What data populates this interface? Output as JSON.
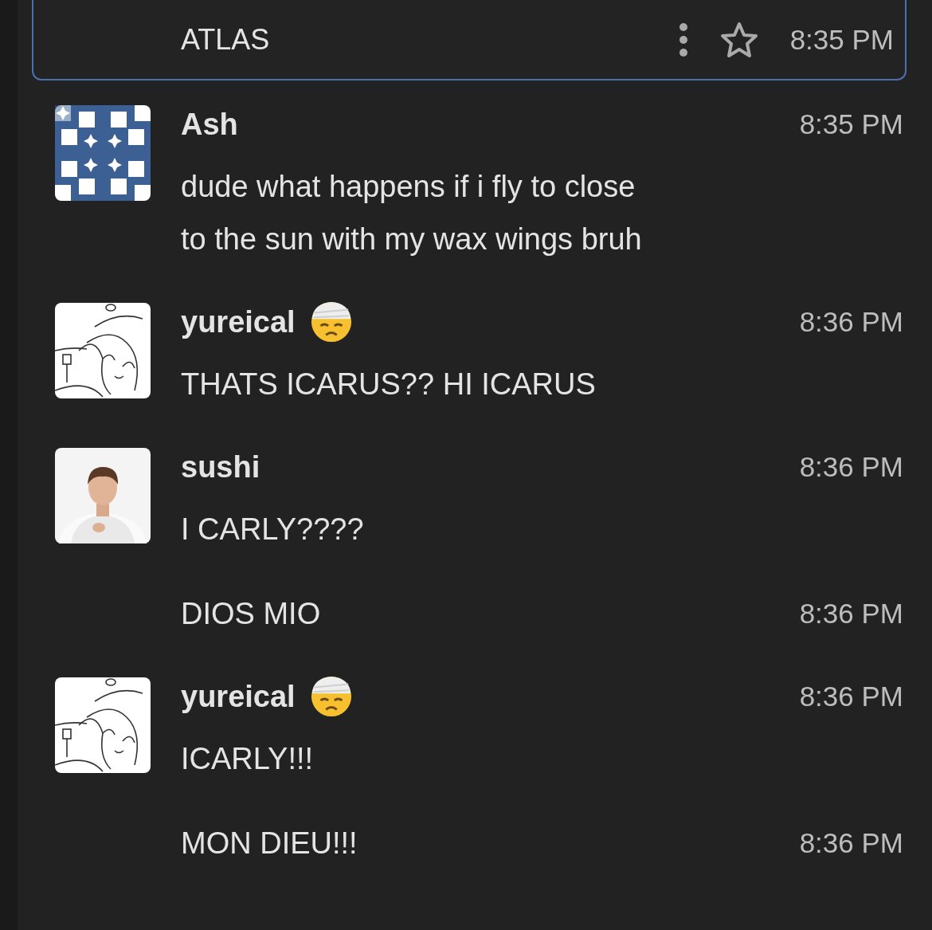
{
  "messages": [
    {
      "kind": "highlighted",
      "selected": true,
      "text": "ATLAS",
      "time": "8:35 PM"
    },
    {
      "kind": "header",
      "author": "Ash",
      "avatar": {
        "kind": "pattern"
      },
      "status_emoji": false,
      "text": "dude what happens if i fly to close to the sun with my wax wings bruh",
      "time": "8:35 PM"
    },
    {
      "kind": "header",
      "author": "yureical",
      "avatar": {
        "kind": "sketch"
      },
      "status_emoji": true,
      "text": "THATS ICARUS?? HI ICARUS",
      "time": "8:36 PM"
    },
    {
      "kind": "header",
      "author": "sushi",
      "status_emoji": false,
      "text": "I CARLY????",
      "time": "8:36 PM"
    },
    {
      "kind": "continuation",
      "text": "DIOS MIO",
      "time": "8:36 PM"
    },
    {
      "kind": "header",
      "author": "yureical",
      "avatar": {
        "kind": "sketch"
      },
      "status_emoji": true,
      "text": "ICARLY!!!",
      "time": "8:36 PM"
    },
    {
      "kind": "continuation",
      "text": "MON DIEU!!!",
      "time": "8:36 PM"
    }
  ]
}
